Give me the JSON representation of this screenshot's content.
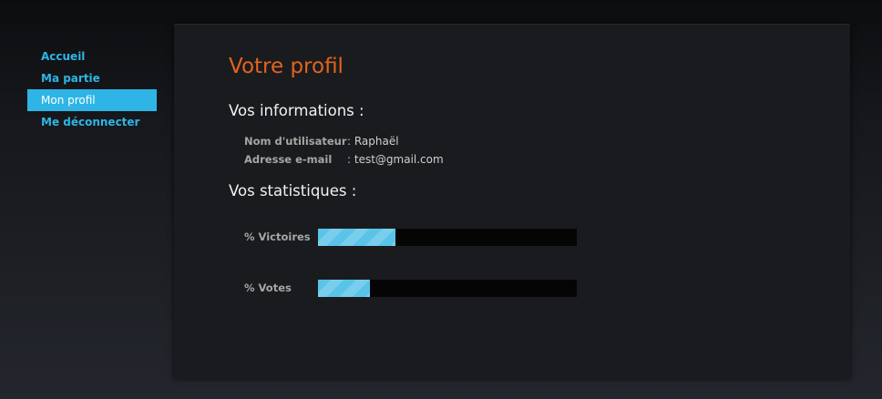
{
  "nav": {
    "items": [
      {
        "label": "Accueil",
        "active": false
      },
      {
        "label": "Ma partie",
        "active": false
      },
      {
        "label": "Mon profil",
        "active": true
      },
      {
        "label": "Me déconnecter",
        "active": false
      }
    ]
  },
  "profile": {
    "title": "Votre profil",
    "info_heading": "Vos informations :",
    "username_label": "Nom d'utilisateur",
    "username_sep": ": ",
    "username_value": "Raphaël",
    "email_label": "Adresse e-mail",
    "email_sep": ": ",
    "email_value": "test@gmail.com",
    "stats_heading": "Vos statistiques :",
    "stats": [
      {
        "label": "% Victoires",
        "fraction": 0.3
      },
      {
        "label": "% Votes",
        "fraction": 0.2
      }
    ]
  },
  "colors": {
    "accent": "#2eb5e6",
    "title": "#e2631f",
    "bar_fill": "#5ac4e8",
    "bar_track": "#050505"
  }
}
